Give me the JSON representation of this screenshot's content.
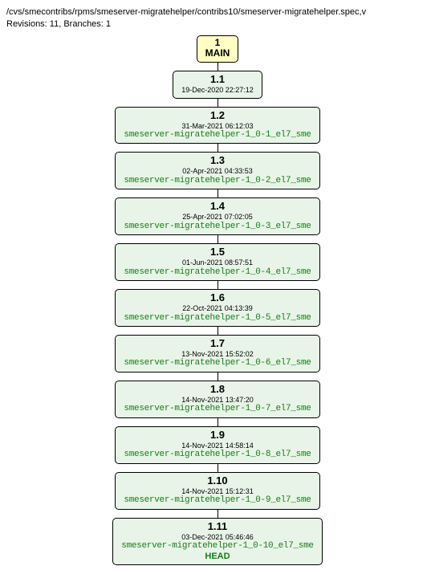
{
  "header": {
    "path": "/cvs/smecontribs/rpms/smeserver-migratehelper/contribs10/smeserver-migratehelper.spec,v",
    "meta": "Revisions: 11, Branches: 1"
  },
  "branch": {
    "num": "1",
    "name": "MAIN"
  },
  "revisions": [
    {
      "rev": "1.1",
      "date": "19-Dec-2020 22:27:12",
      "tag": ""
    },
    {
      "rev": "1.2",
      "date": "31-Mar-2021 06:12:03",
      "tag": "smeserver-migratehelper-1_0-1_el7_sme"
    },
    {
      "rev": "1.3",
      "date": "02-Apr-2021 04:33:53",
      "tag": "smeserver-migratehelper-1_0-2_el7_sme"
    },
    {
      "rev": "1.4",
      "date": "25-Apr-2021 07:02:05",
      "tag": "smeserver-migratehelper-1_0-3_el7_sme"
    },
    {
      "rev": "1.5",
      "date": "01-Jun-2021 08:57:51",
      "tag": "smeserver-migratehelper-1_0-4_el7_sme"
    },
    {
      "rev": "1.6",
      "date": "22-Oct-2021 04:13:39",
      "tag": "smeserver-migratehelper-1_0-5_el7_sme"
    },
    {
      "rev": "1.7",
      "date": "13-Nov-2021 15:52:02",
      "tag": "smeserver-migratehelper-1_0-6_el7_sme"
    },
    {
      "rev": "1.8",
      "date": "14-Nov-2021 13:47:20",
      "tag": "smeserver-migratehelper-1_0-7_el7_sme"
    },
    {
      "rev": "1.9",
      "date": "14-Nov-2021 14:58:14",
      "tag": "smeserver-migratehelper-1_0-8_el7_sme"
    },
    {
      "rev": "1.10",
      "date": "14-Nov-2021 15:12:31",
      "tag": "smeserver-migratehelper-1_0-9_el7_sme"
    },
    {
      "rev": "1.11",
      "date": "03-Dec-2021 05:46:46",
      "tag": "smeserver-migratehelper-1_0-10_el7_sme",
      "head": "HEAD"
    }
  ]
}
